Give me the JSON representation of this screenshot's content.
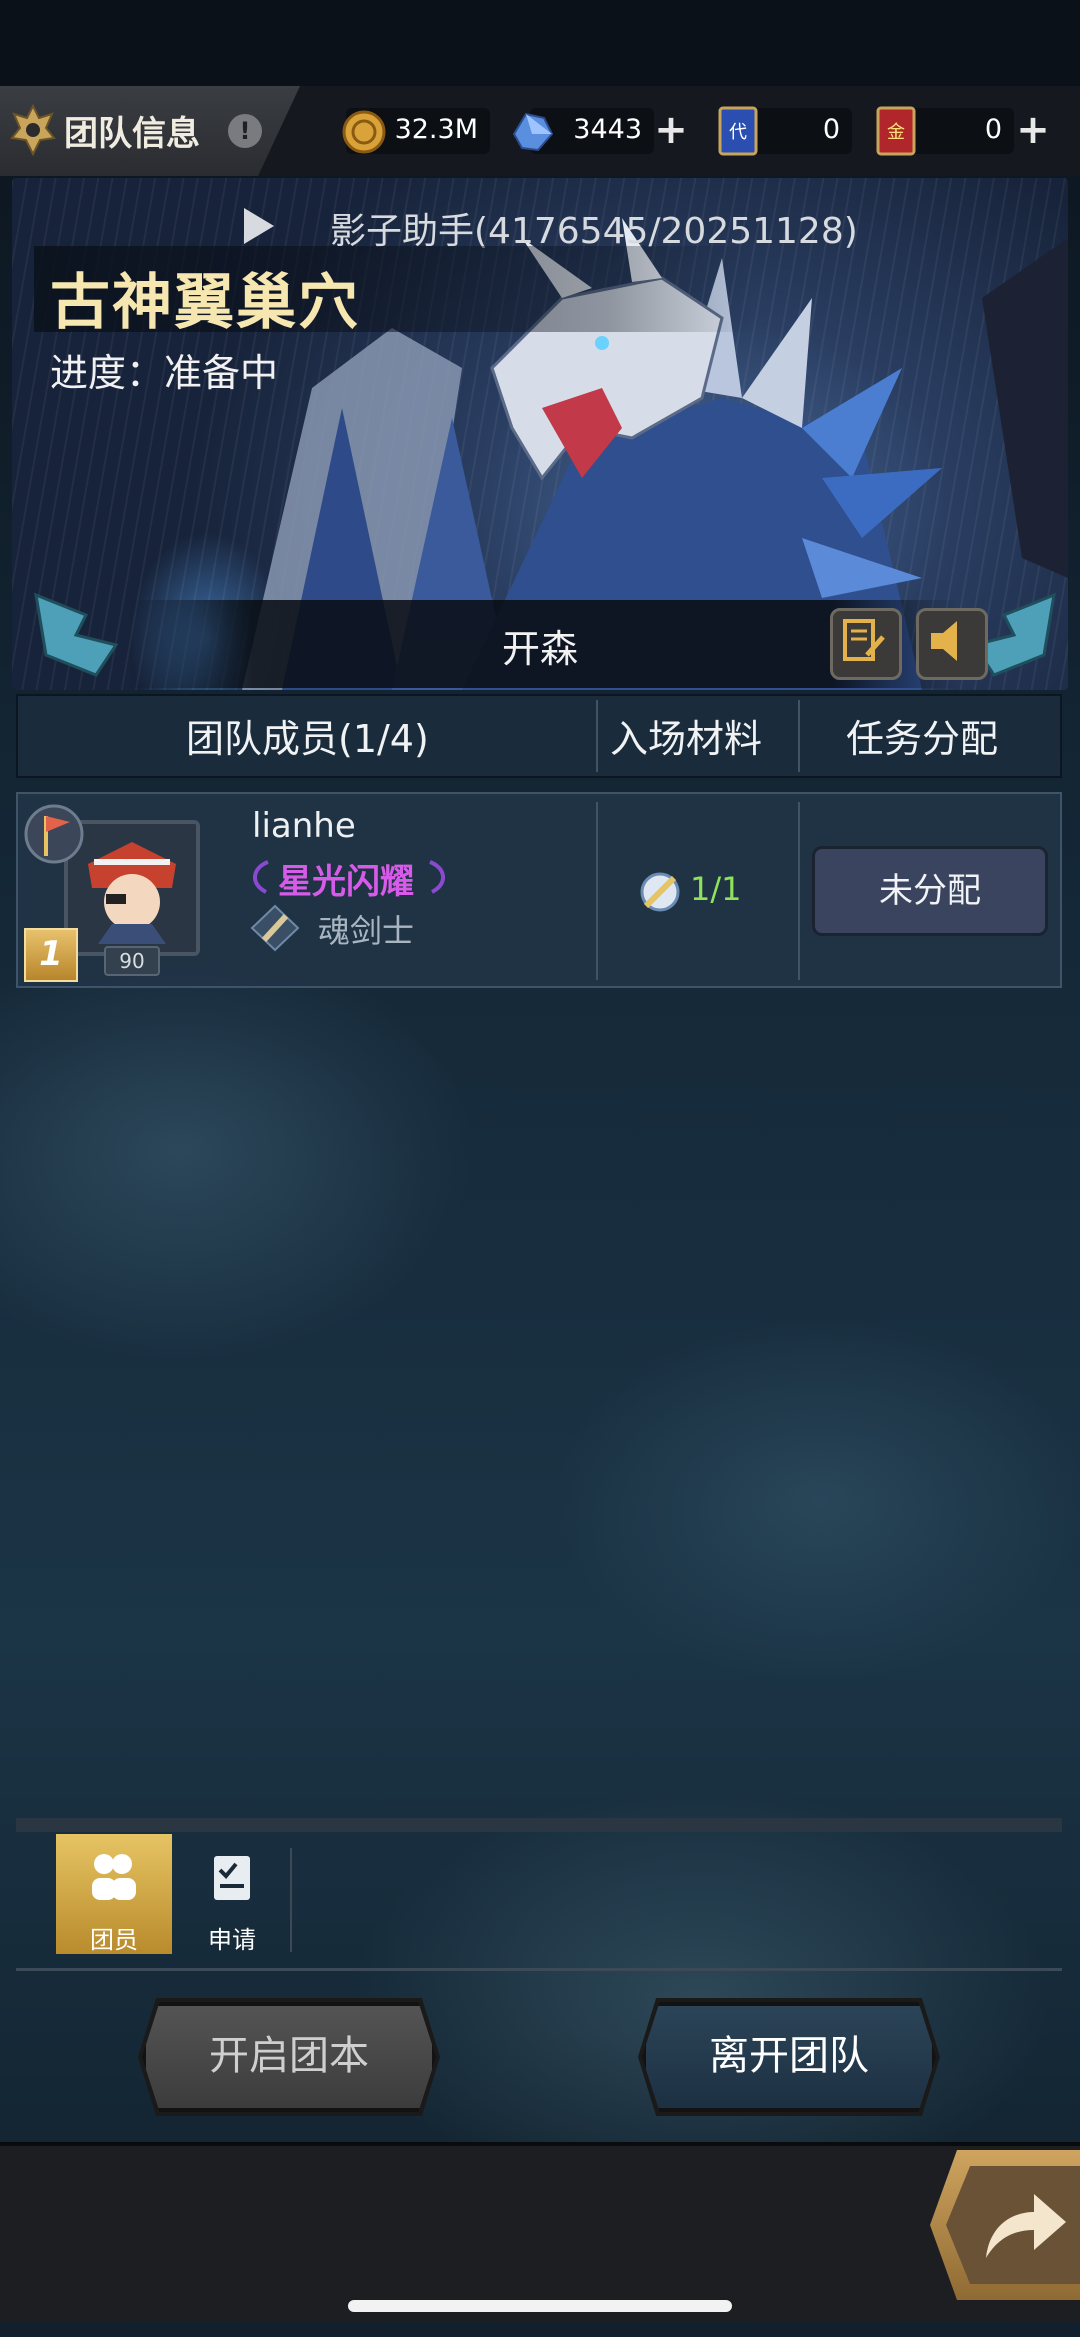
{
  "header": {
    "title": "团队信息",
    "info_icon": "!",
    "resources": {
      "gold": "32.3M",
      "crystal": "3443",
      "ticket_blue": "0",
      "ticket_red": "0"
    },
    "ticket_blue_glyph": "代",
    "ticket_red_glyph": "金"
  },
  "banner": {
    "helper": "影子助手(4176545/20251128)",
    "dungeon_name": "古神翼巢穴",
    "progress": "进度：准备中",
    "leader": "开森"
  },
  "table": {
    "col_members": "团队成员(1/4)",
    "col_materials": "入场材料",
    "col_assign": "任务分配"
  },
  "members": [
    {
      "rank": "1",
      "level": "90",
      "name": "lianhe",
      "title": "星光闪耀",
      "class": "魂剑士",
      "materials": "1/1",
      "assign_label": "未分配"
    }
  ],
  "tabs": [
    {
      "label": "团员",
      "active": true
    },
    {
      "label": "申请",
      "active": false
    }
  ],
  "actions": {
    "start": "开启团本",
    "leave": "离开团队"
  },
  "colors": {
    "gold_accent": "#e6c463",
    "title_purple": "#d65be8",
    "material_green": "#8fe35a"
  }
}
